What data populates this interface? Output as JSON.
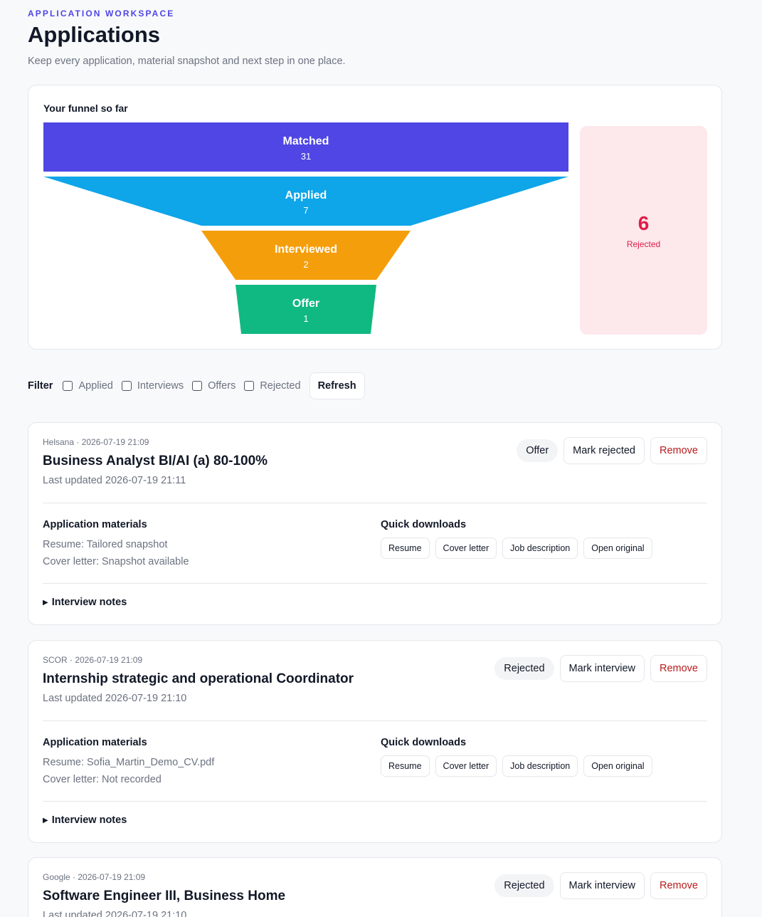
{
  "header": {
    "eyebrow": "APPLICATION WORKSPACE",
    "title": "Applications",
    "subtitle": "Keep every application, material snapshot and next step in one place."
  },
  "funnel": {
    "title": "Your funnel so far",
    "stages": [
      {
        "label": "Matched",
        "count": "31",
        "color": "#4f46e5"
      },
      {
        "label": "Applied",
        "count": "7",
        "color": "#0ea5e9"
      },
      {
        "label": "Interviewed",
        "count": "2",
        "color": "#f59e0b"
      },
      {
        "label": "Offer",
        "count": "1",
        "color": "#10b981"
      }
    ],
    "rejected": {
      "count": "6",
      "label": "Rejected",
      "color": "#e11d48"
    }
  },
  "filter": {
    "label": "Filter",
    "options": [
      "Applied",
      "Interviews",
      "Offers",
      "Rejected"
    ],
    "refresh_label": "Refresh"
  },
  "applications": [
    {
      "meta": "Helsana · 2026-07-19 21:09",
      "title": "Business Analyst BI/AI (a) 80-100%",
      "updated": "Last updated 2026-07-19 21:11",
      "status": "Offer",
      "action": "Mark rejected",
      "remove": "Remove",
      "materials_title": "Application materials",
      "resume": "Resume: Tailored snapshot",
      "cover_letter": "Cover letter: Snapshot available",
      "downloads_title": "Quick downloads",
      "downloads": [
        "Resume",
        "Cover letter",
        "Job description",
        "Open original"
      ],
      "notes": "Interview notes"
    },
    {
      "meta": "SCOR · 2026-07-19 21:09",
      "title": "Internship strategic and operational Coordinator",
      "updated": "Last updated 2026-07-19 21:10",
      "status": "Rejected",
      "action": "Mark interview",
      "remove": "Remove",
      "materials_title": "Application materials",
      "resume": "Resume: Sofia_Martin_Demo_CV.pdf",
      "cover_letter": "Cover letter: Not recorded",
      "downloads_title": "Quick downloads",
      "downloads": [
        "Resume",
        "Cover letter",
        "Job description",
        "Open original"
      ],
      "notes": "Interview notes"
    },
    {
      "meta": "Google · 2026-07-19 21:09",
      "title": "Software Engineer III, Business Home",
      "updated": "Last updated 2026-07-19 21:10",
      "status": "Rejected",
      "action": "Mark interview",
      "remove": "Remove"
    }
  ]
}
